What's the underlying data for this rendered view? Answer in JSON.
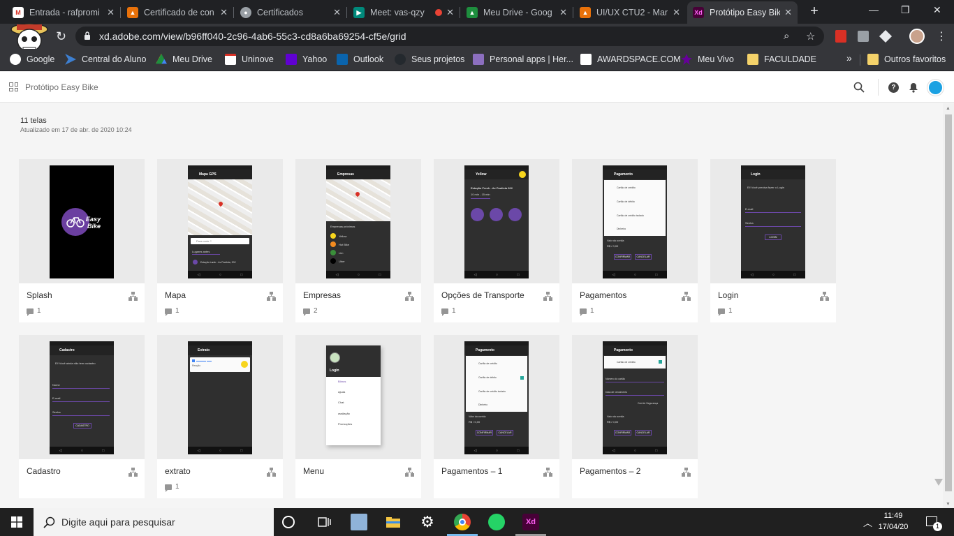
{
  "browser": {
    "tabs": [
      {
        "title": "Entrada - rafpromi",
        "favicon": "gmail-icon",
        "color": "#d93025"
      },
      {
        "title": "Certificado de con",
        "favicon": "classroom-icon",
        "color": "#e8710a"
      },
      {
        "title": "Certificados",
        "favicon": "globe-icon",
        "color": "#9aa0a6"
      },
      {
        "title": "Meet: vas-qzy",
        "favicon": "meet-icon",
        "color": "#00897b"
      },
      {
        "title": "Meu Drive - Goog",
        "favicon": "drive-icon",
        "color": "#1e8e3e"
      },
      {
        "title": "UI/UX CTU2 - Mar",
        "favicon": "classroom-icon",
        "color": "#e8710a"
      },
      {
        "title": "Protótipo Easy Bik",
        "favicon": "xd-icon",
        "color": "#470137"
      }
    ],
    "url": "xd.adobe.com/view/b96ff040-2c96-4ab6-55c3-cd8a6ba69254-cf5e/grid",
    "bookmarks": [
      {
        "label": "Google",
        "icon": "google-icon",
        "color": "#4285f4"
      },
      {
        "label": "Central do Aluno",
        "icon": "arrow-icon",
        "color": "#3d7fd0"
      },
      {
        "label": "Meu Drive",
        "icon": "drive-icon",
        "color": "#1e8e3e"
      },
      {
        "label": "Uninove",
        "icon": "gmail-icon",
        "color": "#d93025"
      },
      {
        "label": "Yahoo",
        "icon": "yahoo-icon",
        "color": "#6001d2"
      },
      {
        "label": "Outlook",
        "icon": "outlook-icon",
        "color": "#0a64ad"
      },
      {
        "label": "Seus projetos",
        "icon": "github-icon",
        "color": "#24292e"
      },
      {
        "label": "Personal apps | Her...",
        "icon": "heroku-icon",
        "color": "#8c6fbf"
      },
      {
        "label": "AWARDSPACE.COM",
        "icon": "awardspace-icon",
        "color": "#ffffff"
      },
      {
        "label": "Meu Vivo",
        "icon": "vivo-icon",
        "color": "#660099"
      },
      {
        "label": "FACULDADE",
        "icon": "folder-icon",
        "color": "#f4d26a"
      },
      {
        "label": "Outros favoritos",
        "icon": "folder-icon",
        "color": "#f4d26a"
      }
    ],
    "more": "»"
  },
  "xd": {
    "project_title": "Protótipo Easy Bike",
    "screen_count": "11 telas",
    "updated": "Atualizado em 17 de abr. de 2020 10:24",
    "accent": "#6b48a8"
  },
  "screens": [
    {
      "name": "Splash",
      "comments": "1"
    },
    {
      "name": "Mapa",
      "comments": "1"
    },
    {
      "name": "Empresas",
      "comments": "2"
    },
    {
      "name": "Opções de Transporte",
      "comments": "1"
    },
    {
      "name": "Pagamentos",
      "comments": "1"
    },
    {
      "name": "Login",
      "comments": "1"
    },
    {
      "name": "Cadastro",
      "comments": ""
    },
    {
      "name": "extrato",
      "comments": "1"
    },
    {
      "name": "Menu",
      "comments": ""
    },
    {
      "name": "Pagamentos – 1",
      "comments": ""
    },
    {
      "name": "Pagamentos – 2",
      "comments": ""
    }
  ],
  "thumbs": {
    "splash_line1": "Easy",
    "splash_line2": "Bike",
    "mapa_title": "Mapa GPS",
    "mapa_search": "Para onde ?",
    "mapa_recent": "Lugares antes",
    "mapa_place": "Estação Lamb - Av Paulista, 302",
    "empresas_title": "Empresas",
    "empresas_sub": "Empresas próximas",
    "empresas_items": [
      "Yellow",
      "Hut Bike",
      "Lim",
      "Uber"
    ],
    "opcoes_title": "Yellow",
    "opcoes_station": "Estação Fresh - Av Paulista 302",
    "opcoes_time": "10 min - 15 min",
    "pag_title": "Pagamento",
    "pag_items": [
      "Cartão de crédito",
      "Cartão de débito",
      "Cartão de crédito isolado",
      "Dinheiro"
    ],
    "pag_total_label": "Valor da corrida",
    "pag_total": "R$ / 0,00",
    "pag_confirm": "CONFIRMAR",
    "pag_cancel": "CANCELAR",
    "login_title": "Login",
    "login_msg": "Ei! Você precisa fazer o Login",
    "login_email": "E-mail",
    "login_pass": "Senha",
    "login_btn": "LOGIN",
    "cad_title": "Cadastro",
    "cad_msg": "Ei! Você ainda não tem cadastro",
    "cad_name": "Nome",
    "cad_email": "E-mail",
    "cad_pass": "Senha",
    "cad_btn": "CADASTRO",
    "extrato_title": "Extrato",
    "extrato_item": "Reação",
    "menu_title": "Login",
    "menu_items": [
      "Bônus",
      "Ajuda",
      "Chat",
      "avaliação",
      "Promoções"
    ],
    "p2_card": "Número do cartão",
    "p2_date": "Data de vencimento",
    "p2_cvv": "Cód de Segurança"
  },
  "taskbar": {
    "search_placeholder": "Digite aqui para pesquisar",
    "time": "11:49",
    "date": "17/04/20",
    "notifications": "1"
  }
}
